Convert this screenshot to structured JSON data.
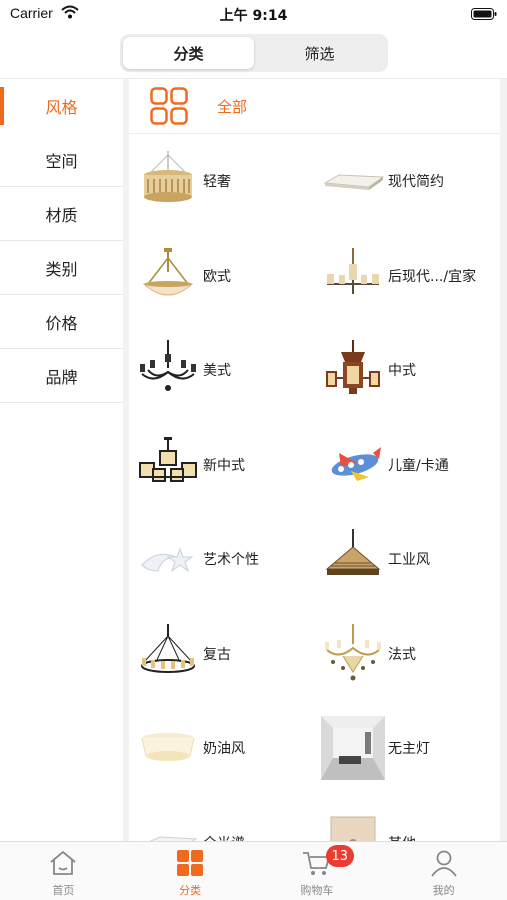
{
  "status_bar": {
    "carrier": "Carrier",
    "time": "上午 9:14"
  },
  "segmented": {
    "tabs": [
      {
        "label": "分类",
        "active": true
      },
      {
        "label": "筛选",
        "active": false
      }
    ]
  },
  "sidebar": {
    "items": [
      {
        "label": "风格",
        "active": true
      },
      {
        "label": "空间"
      },
      {
        "label": "材质"
      },
      {
        "label": "类别"
      },
      {
        "label": "价格"
      },
      {
        "label": "品牌"
      }
    ]
  },
  "content": {
    "all_label": "全部",
    "items": [
      {
        "label": "轻奢",
        "icon": "crystal-chandelier-icon"
      },
      {
        "label": "现代简约",
        "icon": "flat-ceiling-lamp-icon"
      },
      {
        "label": "欧式",
        "icon": "european-pendant-icon"
      },
      {
        "label": "后现代.../宜家",
        "icon": "postmodern-chandelier-icon"
      },
      {
        "label": "美式",
        "icon": "american-chandelier-icon"
      },
      {
        "label": "中式",
        "icon": "chinese-lantern-chandelier-icon"
      },
      {
        "label": "新中式",
        "icon": "new-chinese-chandelier-icon"
      },
      {
        "label": "儿童/卡通",
        "icon": "airplane-lamp-icon"
      },
      {
        "label": "艺术个性",
        "icon": "moon-star-lamp-icon"
      },
      {
        "label": "工业风",
        "icon": "industrial-pendant-icon"
      },
      {
        "label": "复古",
        "icon": "vintage-wheel-chandelier-icon"
      },
      {
        "label": "法式",
        "icon": "french-chandelier-icon"
      },
      {
        "label": "奶油风",
        "icon": "cream-ceiling-lamp-icon"
      },
      {
        "label": "无主灯",
        "icon": "room-photo-icon"
      },
      {
        "label": "全光谱",
        "icon": "ceiling-panel-icon"
      },
      {
        "label": "其他",
        "icon": "wall-switch-icon"
      }
    ]
  },
  "tabbar": {
    "tabs": [
      {
        "label": "首页",
        "icon": "home-icon"
      },
      {
        "label": "分类",
        "icon": "category-icon",
        "active": true
      },
      {
        "label": "购物车",
        "icon": "cart-icon",
        "badge": "13"
      },
      {
        "label": "我的",
        "icon": "user-icon"
      }
    ]
  },
  "colors": {
    "accent": "#f06a1d",
    "badge": "#ec3b30"
  }
}
